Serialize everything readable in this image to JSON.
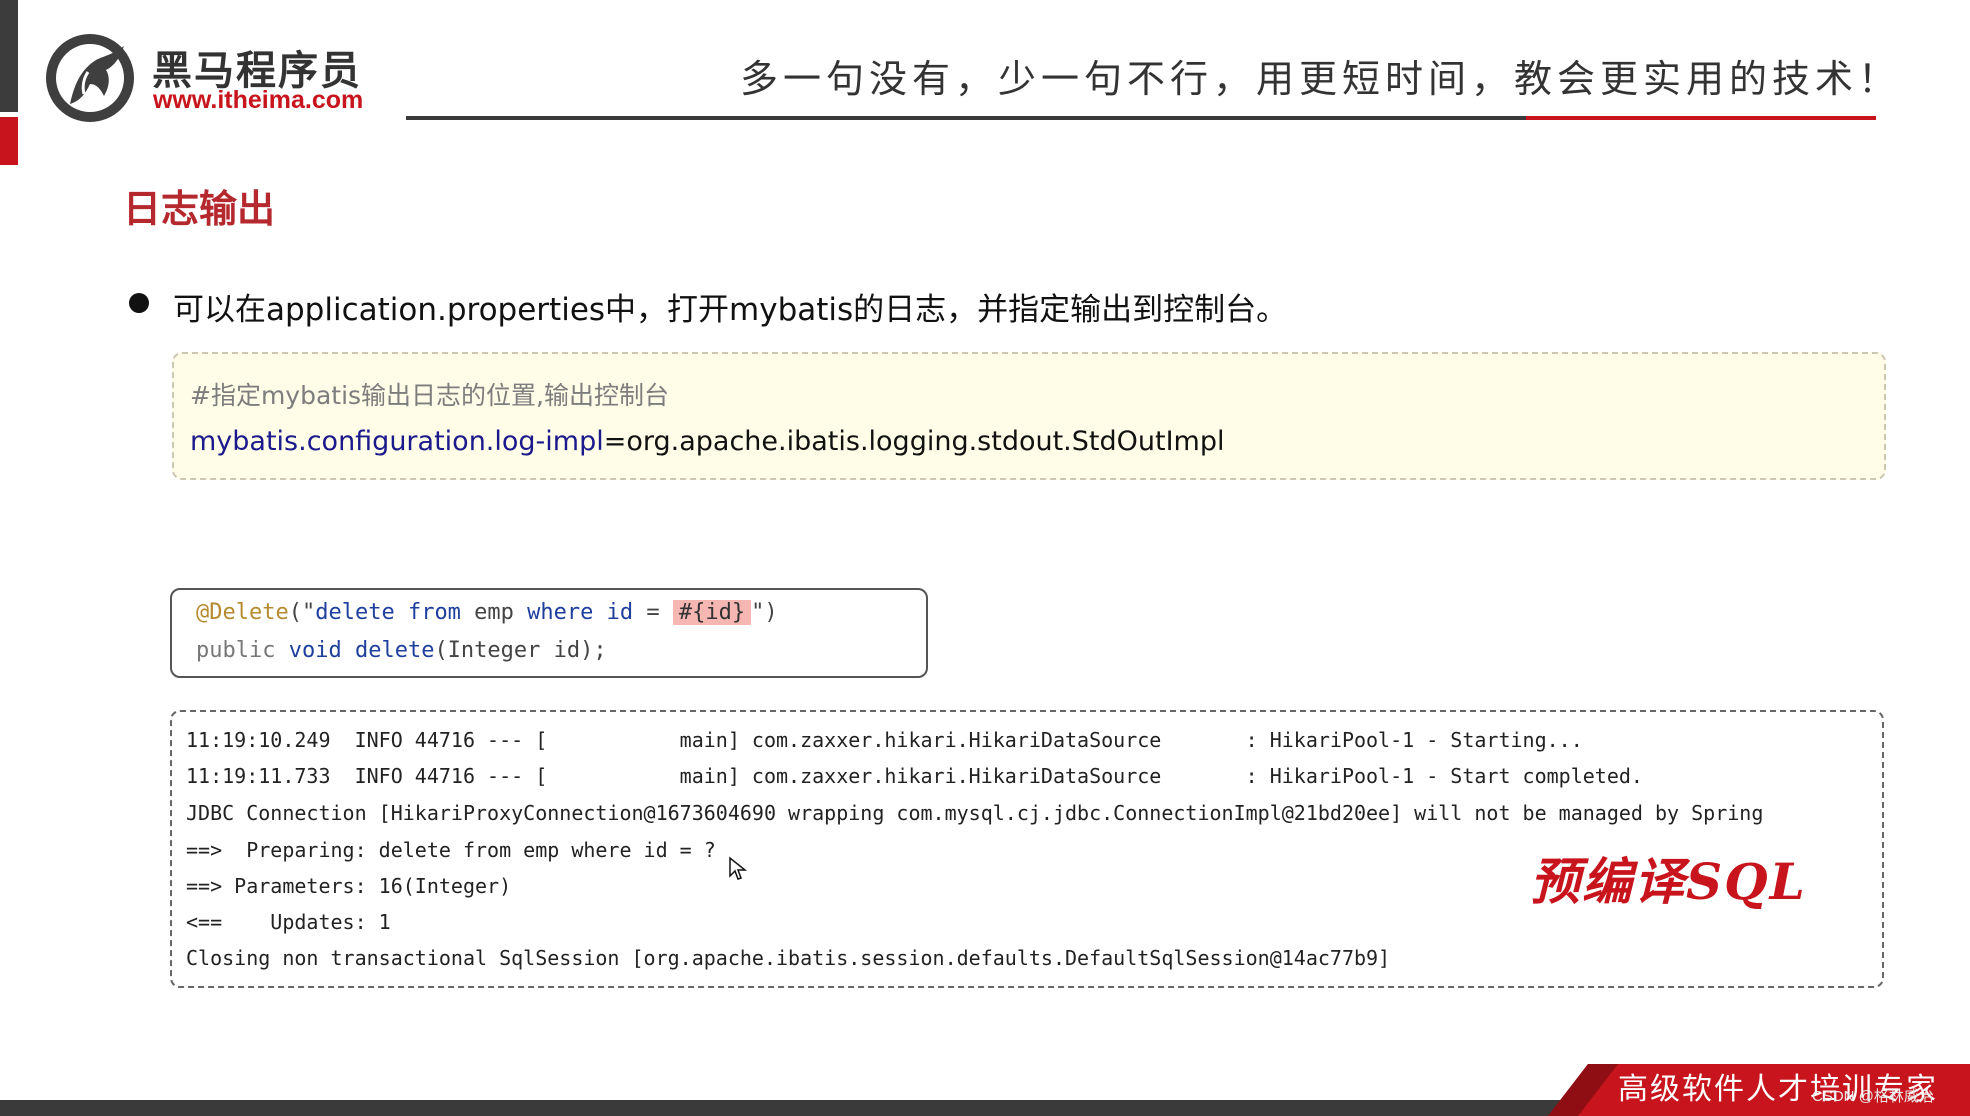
{
  "header": {
    "logo_cn": "黑马程序员",
    "logo_url": "www.itheima.com",
    "slogan": "多一句没有，少一句不行，用更短时间，教会更实用的技术！"
  },
  "title": "日志输出",
  "bullet": "可以在application.properties中，打开mybatis的日志，并指定输出到控制台。",
  "config": {
    "comment": "#指定mybatis输出日志的位置,输出控制台",
    "key": "mybatis.configuration.log-impl",
    "eq": "=",
    "value": "org.apache.ibatis.logging.stdout.StdOutImpl"
  },
  "code": {
    "annotation": "@Delete",
    "open": "(\"",
    "sql_delete": "delete",
    "sql_from": " from",
    "sql_emp": " emp ",
    "sql_where": "where",
    "sql_id": " id ",
    "sql_eq": "= ",
    "param": "#{id}",
    "close": "\")",
    "line2_public": "public",
    "line2_void": " void",
    "line2_method": " delete",
    "line2_args": "(Integer id);"
  },
  "log": {
    "lines": [
      "11:19:10.249  INFO 44716 --- [           main] com.zaxxer.hikari.HikariDataSource       : HikariPool-1 - Starting...",
      "11:19:11.733  INFO 44716 --- [           main] com.zaxxer.hikari.HikariDataSource       : HikariPool-1 - Start completed.",
      "JDBC Connection [HikariProxyConnection@1673604690 wrapping com.mysql.cj.jdbc.ConnectionImpl@21bd20ee] will not be managed by Spring",
      "==>  Preparing: delete from emp where id = ?",
      "==> Parameters: 16(Integer)",
      "<==    Updates: 1",
      "Closing non transactional SqlSession [org.apache.ibatis.session.defaults.DefaultSqlSession@14ac77b9]"
    ],
    "badge": "预编译SQL"
  },
  "footer": {
    "text": "高级软件人才培训专家",
    "watermark": "CSDN @格林威治"
  },
  "colors": {
    "brand_red": "#c8141c",
    "title_red": "#b5282e",
    "config_bg": "#fffce8",
    "highlight_bg": "#fde0df"
  }
}
